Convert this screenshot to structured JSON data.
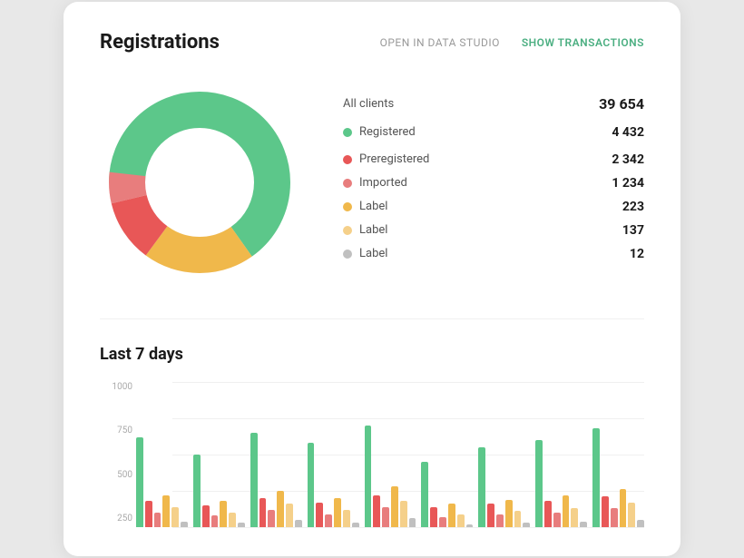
{
  "header": {
    "title": "Registrations",
    "open_data_studio_label": "OPEN IN DATA STUDIO",
    "show_transactions_label": "SHOW TRANSACTIONS"
  },
  "legend": {
    "all_clients": {
      "label": "All clients",
      "value": "39 654"
    },
    "items": [
      {
        "label": "Registered",
        "value": "4 432",
        "color": "#5cc78a"
      },
      {
        "label": "Preregistered",
        "value": "2 342",
        "color": "#e85757"
      },
      {
        "label": "Imported",
        "value": "1 234",
        "color": "#e87d7d"
      },
      {
        "label": "Label",
        "value": "223",
        "color": "#f0b84b"
      },
      {
        "label": "Label",
        "value": "137",
        "color": "#f5d08a"
      },
      {
        "label": "Label",
        "value": "12",
        "color": "#c0c0c0"
      }
    ]
  },
  "bar_chart": {
    "title": "Last 7 days",
    "y_labels": [
      "1000",
      "750",
      "500",
      "250"
    ],
    "colors": {
      "green": "#5cc78a",
      "red": "#e85757",
      "pink": "#e87d7d",
      "orange": "#f0b84b",
      "light_orange": "#f5d08a",
      "gray": "#c0c0c0"
    },
    "groups": [
      [
        0.62,
        0.18,
        0.1,
        0.22,
        0.14,
        0.04
      ],
      [
        0.5,
        0.15,
        0.08,
        0.18,
        0.1,
        0.03
      ],
      [
        0.65,
        0.2,
        0.12,
        0.25,
        0.16,
        0.05
      ],
      [
        0.58,
        0.17,
        0.09,
        0.2,
        0.12,
        0.03
      ],
      [
        0.7,
        0.22,
        0.14,
        0.28,
        0.18,
        0.06
      ],
      [
        0.45,
        0.14,
        0.07,
        0.16,
        0.09,
        0.02
      ],
      [
        0.55,
        0.16,
        0.09,
        0.19,
        0.11,
        0.03
      ],
      [
        0.6,
        0.18,
        0.1,
        0.22,
        0.13,
        0.04
      ],
      [
        0.68,
        0.21,
        0.13,
        0.26,
        0.17,
        0.05
      ]
    ]
  }
}
